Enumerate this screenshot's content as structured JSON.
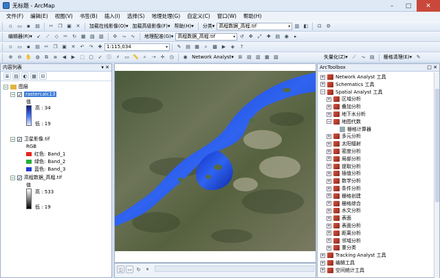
{
  "window": {
    "title": "无标题 - ArcMap",
    "minimize": "–",
    "maximize": "□",
    "close": "✕"
  },
  "menubar": [
    "文件(F)",
    "编辑(E)",
    "视图(V)",
    "书签(B)",
    "插入(I)",
    "选择(S)",
    "地理处理(G)",
    "自定义(C)",
    "窗口(W)",
    "帮助(H)"
  ],
  "toolbar1": {
    "online_label": "加载在线影像(O)▾",
    "hd_label": "加载高级影像(F)▾",
    "help_label": "帮助(H)▾",
    "classify_label": "分类▾",
    "layer_value": "高程数据_高程.tif"
  },
  "toolbar2": {
    "editor_label": "编辑器(R)▾",
    "georef_label": "地理配准(G)▾",
    "georef_layer": "高程数据_高程.tif"
  },
  "toolbar3": {
    "scale_value": "1:115,034"
  },
  "toolbar4": {
    "network_label": "Network Analyst▾",
    "vector_label": "矢量化(Z)▾",
    "raster_clean_label": "栅格清理(E)▾"
  },
  "toc": {
    "title": "内容列表",
    "pin": "▾ ✕",
    "root": "图层",
    "layers": [
      {
        "name": "rastercalc13",
        "value_label": "值",
        "high": "高 : 34",
        "low": "低 : 19"
      },
      {
        "name": "卫星影像.tif",
        "rgb_label": "RGB",
        "bands": [
          {
            "label": "红色:",
            "band": "Band_1",
            "color": "#e8231d"
          },
          {
            "label": "绿色:",
            "band": "Band_2",
            "color": "#22b03a"
          },
          {
            "label": "蓝色:",
            "band": "Band_3",
            "color": "#1f3fd0"
          }
        ]
      },
      {
        "name": "高程数据_高程.tif",
        "value_label": "值",
        "high": "高 : 533",
        "low": "低 : 19"
      }
    ]
  },
  "arctoolbox": {
    "title": "ArcToolbox",
    "pin": "□ ✕",
    "items": [
      {
        "label": "Network Analyst 工具",
        "level": 0,
        "exp": "+",
        "kind": "box"
      },
      {
        "label": "Schematics 工具",
        "level": 0,
        "exp": "+",
        "kind": "box"
      },
      {
        "label": "Spatial Analyst 工具",
        "level": 0,
        "exp": "−",
        "kind": "box"
      },
      {
        "label": "区域分析",
        "level": 1,
        "exp": "+",
        "kind": "box"
      },
      {
        "label": "叠加分析",
        "level": 1,
        "exp": "+",
        "kind": "box"
      },
      {
        "label": "地下水分析",
        "level": 1,
        "exp": "+",
        "kind": "box"
      },
      {
        "label": "地图代数",
        "level": 1,
        "exp": "−",
        "kind": "box"
      },
      {
        "label": "栅格计算器",
        "level": 2,
        "exp": "",
        "kind": "tool"
      },
      {
        "label": "多元分析",
        "level": 1,
        "exp": "+",
        "kind": "box"
      },
      {
        "label": "太阳辐射",
        "level": 1,
        "exp": "+",
        "kind": "box"
      },
      {
        "label": "密度分析",
        "level": 1,
        "exp": "+",
        "kind": "box"
      },
      {
        "label": "局部分析",
        "level": 1,
        "exp": "+",
        "kind": "box"
      },
      {
        "label": "提取分析",
        "level": 1,
        "exp": "+",
        "kind": "box"
      },
      {
        "label": "插值分析",
        "level": 1,
        "exp": "+",
        "kind": "box"
      },
      {
        "label": "数学分析",
        "level": 1,
        "exp": "+",
        "kind": "box"
      },
      {
        "label": "条件分析",
        "level": 1,
        "exp": "+",
        "kind": "box"
      },
      {
        "label": "栅格创建",
        "level": 1,
        "exp": "+",
        "kind": "box"
      },
      {
        "label": "栅格综合",
        "level": 1,
        "exp": "+",
        "kind": "box"
      },
      {
        "label": "水文分析",
        "level": 1,
        "exp": "+",
        "kind": "box"
      },
      {
        "label": "表面",
        "level": 1,
        "exp": "+",
        "kind": "box"
      },
      {
        "label": "表面分析",
        "level": 1,
        "exp": "+",
        "kind": "box"
      },
      {
        "label": "距离分析",
        "level": 1,
        "exp": "+",
        "kind": "box"
      },
      {
        "label": "邻域分析",
        "level": 1,
        "exp": "+",
        "kind": "box"
      },
      {
        "label": "重分类",
        "level": 1,
        "exp": "+",
        "kind": "box"
      },
      {
        "label": "Tracking Analyst 工具",
        "level": 0,
        "exp": "+",
        "kind": "box"
      },
      {
        "label": "编辑工具",
        "level": 0,
        "exp": "+",
        "kind": "box"
      },
      {
        "label": "空间统计工具",
        "level": 0,
        "exp": "+",
        "kind": "box"
      }
    ]
  }
}
